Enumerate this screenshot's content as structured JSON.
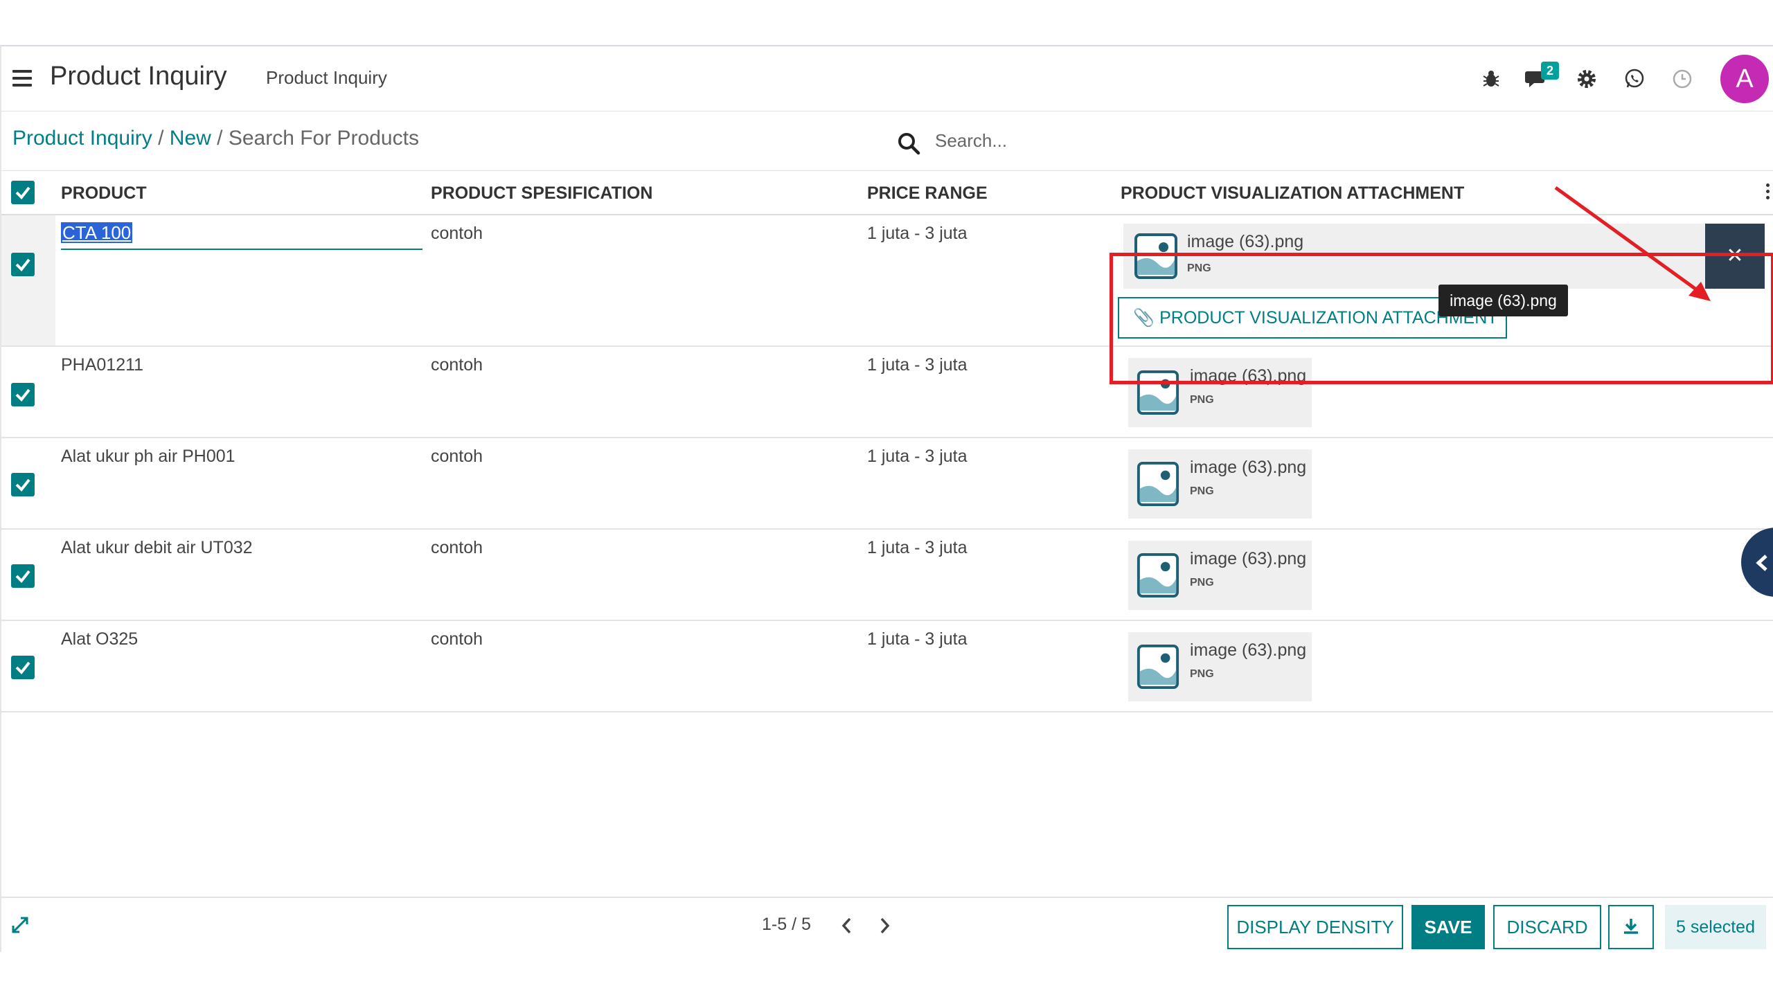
{
  "header": {
    "app_title": "Product Inquiry",
    "menu_label": "Product Inquiry",
    "message_count": "2",
    "avatar_letter": "A",
    "avatar_color": "#c52ab5"
  },
  "breadcrumb": {
    "item1": "Product Inquiry",
    "sep1": " / ",
    "item2": "New",
    "sep2": " / ",
    "current": "Search For Products"
  },
  "search": {
    "placeholder": "Search..."
  },
  "table": {
    "columns": [
      "PRODUCT",
      "PRODUCT SPESIFICATION",
      "PRICE RANGE",
      "PRODUCT VISUALIZATION ATTACHMENT"
    ],
    "rows": [
      {
        "product": "CTA 100",
        "spec": "contoh",
        "price": "1 juta - 3 juta",
        "attachment_name": "image (63).png",
        "attachment_ext": "PNG",
        "checked": true,
        "editing": true
      },
      {
        "product": "PHA01211",
        "spec": "contoh",
        "price": "1 juta - 3 juta",
        "attachment_name": "image (63).png",
        "attachment_ext": "PNG",
        "checked": true
      },
      {
        "product": "Alat ukur ph air PH001",
        "spec": "contoh",
        "price": "1 juta - 3 juta",
        "attachment_name": "image (63).png",
        "attachment_ext": "PNG",
        "checked": true
      },
      {
        "product": "Alat ukur debit air UT032",
        "spec": "contoh",
        "price": "1 juta - 3 juta",
        "attachment_name": "image (63).png",
        "attachment_ext": "PNG",
        "checked": true
      },
      {
        "product": "Alat O325",
        "spec": "contoh",
        "price": "1 juta - 3 juta",
        "attachment_name": "image (63).png",
        "attachment_ext": "PNG",
        "checked": true
      }
    ],
    "attach_button_label": "PRODUCT VISUALIZATION ATTACHMENT",
    "tooltip": "image (63).png"
  },
  "footer": {
    "pager": "1-5 / 5",
    "display_density": "DISPLAY DENSITY",
    "save": "SAVE",
    "discard": "DISCARD",
    "selected": "5 selected"
  },
  "colors": {
    "accent": "#017e84",
    "annotation": "#e31e24",
    "dark_button": "#2c3e50"
  }
}
